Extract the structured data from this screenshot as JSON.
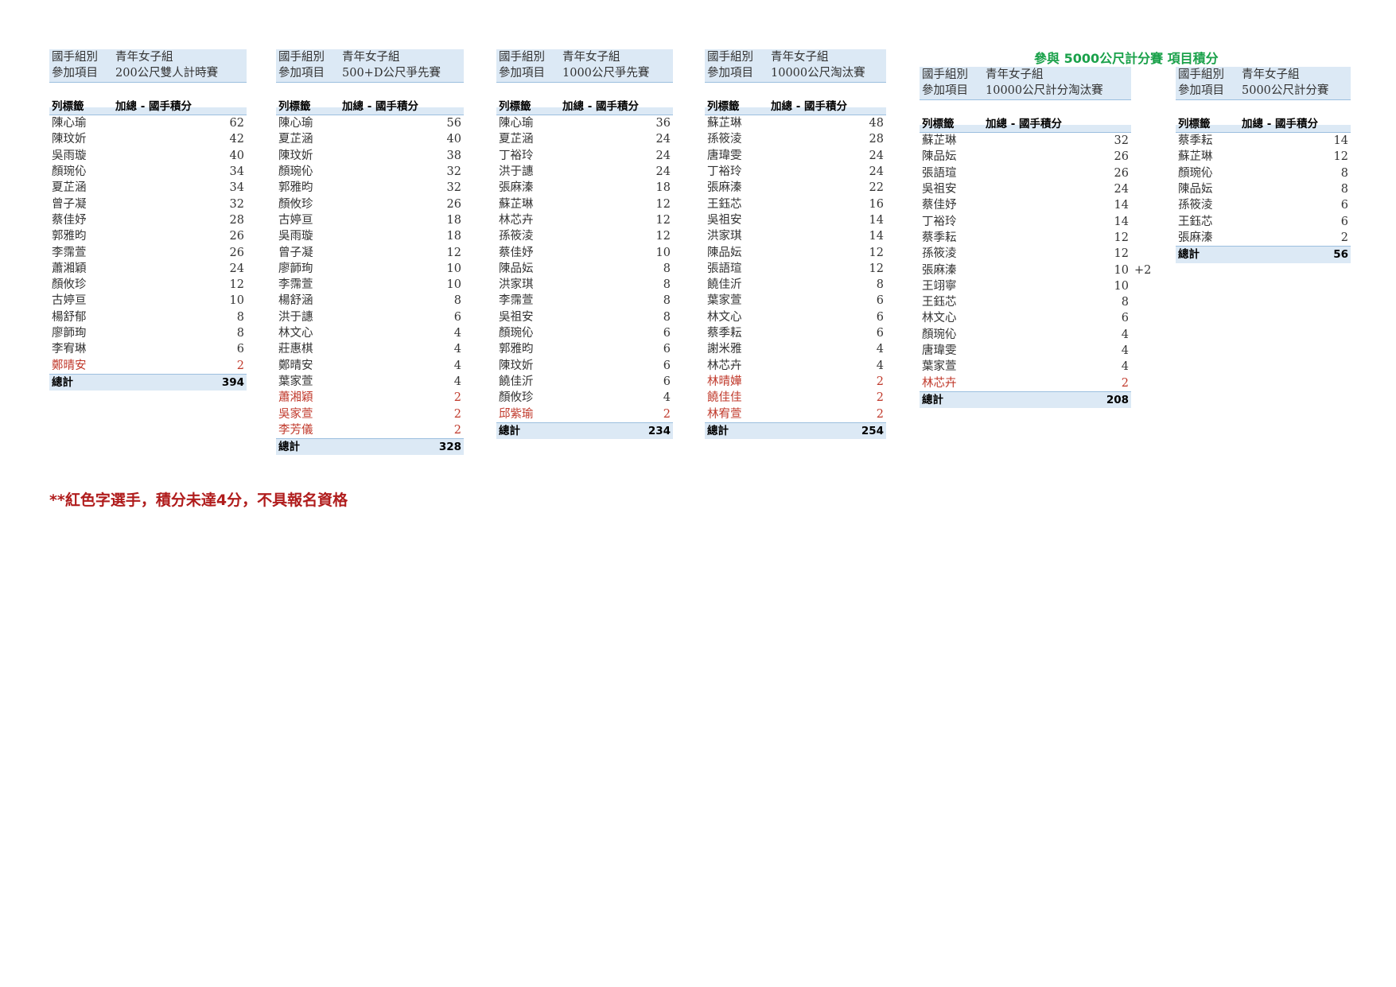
{
  "section_title": "參與 5000公尺計分賽 項目積分",
  "note": "**紅色字選手，積分未達4分，不具報名資格",
  "labels": {
    "group_key": "國手組別",
    "event_key": "參加項目",
    "row_label": "列標籤",
    "sum_label": "加總 - 國手積分",
    "total_label": "總計"
  },
  "colors": {
    "header_fill": "#dce9f5",
    "border": "#9cbfdf",
    "ineligible": "#c0392b",
    "section_title": "#1aa14a",
    "note": "#b01c1c"
  },
  "tables": [
    {
      "group": "青年女子組",
      "event": "200公尺雙人計時賽",
      "rows": [
        {
          "name": "陳心瑜",
          "value": "62",
          "red": false
        },
        {
          "name": "陳玟妡",
          "value": "42",
          "red": false
        },
        {
          "name": "吳雨璇",
          "value": "40",
          "red": false
        },
        {
          "name": "顏琬伈",
          "value": "34",
          "red": false
        },
        {
          "name": "夏芷涵",
          "value": "34",
          "red": false
        },
        {
          "name": "曾子凝",
          "value": "32",
          "red": false
        },
        {
          "name": "蔡佳妤",
          "value": "28",
          "red": false
        },
        {
          "name": "郭雅昀",
          "value": "26",
          "red": false
        },
        {
          "name": "李霈萱",
          "value": "26",
          "red": false
        },
        {
          "name": "蕭湘穎",
          "value": "24",
          "red": false
        },
        {
          "name": "顏攸珍",
          "value": "12",
          "red": false
        },
        {
          "name": "古婷亘",
          "value": "10",
          "red": false
        },
        {
          "name": "楊舒郁",
          "value": "8",
          "red": false
        },
        {
          "name": "廖韴珣",
          "value": "8",
          "red": false
        },
        {
          "name": "李宥琳",
          "value": "6",
          "red": false
        },
        {
          "name": "鄭晴安",
          "value": "2",
          "red": true
        }
      ],
      "total": "394"
    },
    {
      "group": "青年女子組",
      "event": "500+D公尺爭先賽",
      "rows": [
        {
          "name": "陳心瑜",
          "value": "56",
          "red": false
        },
        {
          "name": "夏芷涵",
          "value": "40",
          "red": false
        },
        {
          "name": "陳玟妡",
          "value": "38",
          "red": false
        },
        {
          "name": "顏琬伈",
          "value": "32",
          "red": false
        },
        {
          "name": "郭雅昀",
          "value": "32",
          "red": false
        },
        {
          "name": "顏攸珍",
          "value": "26",
          "red": false
        },
        {
          "name": "古婷亘",
          "value": "18",
          "red": false
        },
        {
          "name": "吳雨璇",
          "value": "18",
          "red": false
        },
        {
          "name": "曾子凝",
          "value": "12",
          "red": false
        },
        {
          "name": "廖韴珣",
          "value": "10",
          "red": false
        },
        {
          "name": "李霈萱",
          "value": "10",
          "red": false
        },
        {
          "name": "楊舒涵",
          "value": "8",
          "red": false
        },
        {
          "name": "洪于譓",
          "value": "6",
          "red": false
        },
        {
          "name": "林文心",
          "value": "4",
          "red": false
        },
        {
          "name": "莊惠棋",
          "value": "4",
          "red": false
        },
        {
          "name": "鄭晴安",
          "value": "4",
          "red": false
        },
        {
          "name": "葉家萱",
          "value": "4",
          "red": false
        },
        {
          "name": "蕭湘穎",
          "value": "2",
          "red": true
        },
        {
          "name": "吳家萱",
          "value": "2",
          "red": true
        },
        {
          "name": "李芳儀",
          "value": "2",
          "red": true
        }
      ],
      "total": "328"
    },
    {
      "group": "青年女子組",
      "event": "1000公尺爭先賽",
      "rows": [
        {
          "name": "陳心瑜",
          "value": "36",
          "red": false
        },
        {
          "name": "夏芷涵",
          "value": "24",
          "red": false
        },
        {
          "name": "丁裕玲",
          "value": "24",
          "red": false
        },
        {
          "name": "洪于譓",
          "value": "24",
          "red": false
        },
        {
          "name": "張麻溱",
          "value": "18",
          "red": false
        },
        {
          "name": "蘇芷琳",
          "value": "12",
          "red": false
        },
        {
          "name": "林芯卉",
          "value": "12",
          "red": false
        },
        {
          "name": "孫筱淩",
          "value": "12",
          "red": false
        },
        {
          "name": "蔡佳妤",
          "value": "10",
          "red": false
        },
        {
          "name": "陳品妘",
          "value": "8",
          "red": false
        },
        {
          "name": "洪家琪",
          "value": "8",
          "red": false
        },
        {
          "name": "李霈萱",
          "value": "8",
          "red": false
        },
        {
          "name": "吳祖安",
          "value": "8",
          "red": false
        },
        {
          "name": "顏琬伈",
          "value": "6",
          "red": false
        },
        {
          "name": "郭雅昀",
          "value": "6",
          "red": false
        },
        {
          "name": "陳玟妡",
          "value": "6",
          "red": false
        },
        {
          "name": "饒佳沂",
          "value": "6",
          "red": false
        },
        {
          "name": "顏攸珍",
          "value": "4",
          "red": false
        },
        {
          "name": "邱紫瑜",
          "value": "2",
          "red": true
        }
      ],
      "total": "234"
    },
    {
      "group": "青年女子組",
      "event": "10000公尺淘汰賽",
      "rows": [
        {
          "name": "蘇芷琳",
          "value": "48",
          "red": false
        },
        {
          "name": "孫筱淩",
          "value": "28",
          "red": false
        },
        {
          "name": "唐瑋雯",
          "value": "24",
          "red": false
        },
        {
          "name": "丁裕玲",
          "value": "24",
          "red": false
        },
        {
          "name": "張麻溱",
          "value": "22",
          "red": false
        },
        {
          "name": "王鈺芯",
          "value": "16",
          "red": false
        },
        {
          "name": "吳祖安",
          "value": "14",
          "red": false
        },
        {
          "name": "洪家琪",
          "value": "14",
          "red": false
        },
        {
          "name": "陳品妘",
          "value": "12",
          "red": false
        },
        {
          "name": "張語瑄",
          "value": "12",
          "red": false
        },
        {
          "name": "饒佳沂",
          "value": "8",
          "red": false
        },
        {
          "name": "葉家萱",
          "value": "6",
          "red": false
        },
        {
          "name": "林文心",
          "value": "6",
          "red": false
        },
        {
          "name": "蔡季耘",
          "value": "6",
          "red": false
        },
        {
          "name": "謝米雅",
          "value": "4",
          "red": false
        },
        {
          "name": "林芯卉",
          "value": "4",
          "red": false
        },
        {
          "name": "林晴嬅",
          "value": "2",
          "red": true
        },
        {
          "name": "饒佳佳",
          "value": "2",
          "red": true
        },
        {
          "name": "林宥萱",
          "value": "2",
          "red": true
        }
      ],
      "total": "254"
    },
    {
      "group": "青年女子組",
      "event": "10000公尺計分淘汰賽",
      "rows": [
        {
          "name": "蘇芷琳",
          "value": "32",
          "red": false
        },
        {
          "name": "陳品妘",
          "value": "26",
          "red": false
        },
        {
          "name": "張語瑄",
          "value": "26",
          "red": false
        },
        {
          "name": "吳祖安",
          "value": "24",
          "red": false
        },
        {
          "name": "蔡佳妤",
          "value": "14",
          "red": false
        },
        {
          "name": "丁裕玲",
          "value": "14",
          "red": false
        },
        {
          "name": "蔡季耘",
          "value": "12",
          "red": false
        },
        {
          "name": "孫筱淩",
          "value": "12",
          "red": false
        },
        {
          "name": "張麻溱",
          "value": "10",
          "red": false,
          "extra": "+2"
        },
        {
          "name": "王翊寧",
          "value": "10",
          "red": false
        },
        {
          "name": "王鈺芯",
          "value": "8",
          "red": false
        },
        {
          "name": "林文心",
          "value": "6",
          "red": false
        },
        {
          "name": "顏琬伈",
          "value": "4",
          "red": false
        },
        {
          "name": "唐瑋雯",
          "value": "4",
          "red": false
        },
        {
          "name": "葉家萱",
          "value": "4",
          "red": false
        },
        {
          "name": "林芯卉",
          "value": "2",
          "red": true
        }
      ],
      "total": "208"
    },
    {
      "group": "青年女子組",
      "event": "5000公尺計分賽",
      "rows": [
        {
          "name": "蔡季耘",
          "value": "14",
          "red": false
        },
        {
          "name": "蘇芷琳",
          "value": "12",
          "red": false
        },
        {
          "name": "顏琬伈",
          "value": "8",
          "red": false
        },
        {
          "name": "陳品妘",
          "value": "8",
          "red": false
        },
        {
          "name": "孫筱淩",
          "value": "6",
          "red": false
        },
        {
          "name": "王鈺芯",
          "value": "6",
          "red": false
        },
        {
          "name": "張麻溱",
          "value": "2",
          "red": false
        }
      ],
      "total": "56"
    }
  ]
}
